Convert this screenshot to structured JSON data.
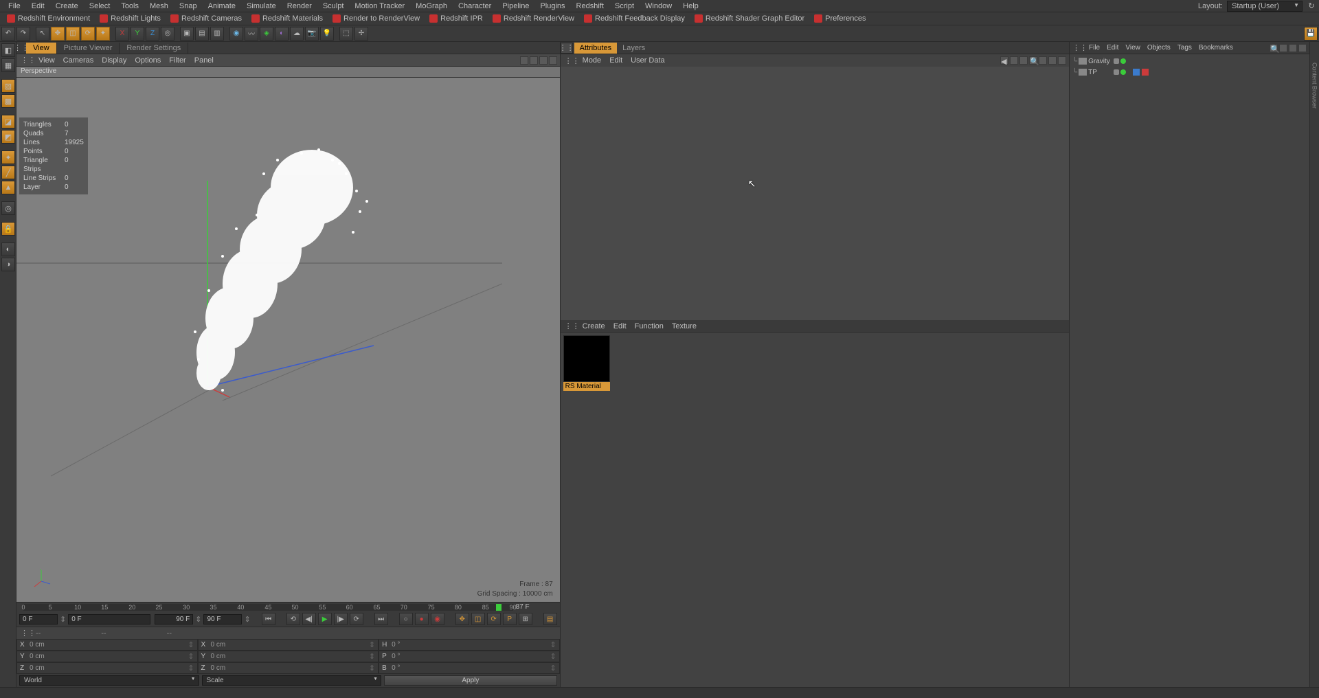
{
  "menubar": [
    "File",
    "Edit",
    "Create",
    "Select",
    "Tools",
    "Mesh",
    "Snap",
    "Animate",
    "Simulate",
    "Render",
    "Sculpt",
    "Motion Tracker",
    "MoGraph",
    "Character",
    "Pipeline",
    "Plugins",
    "Redshift",
    "Script",
    "Window",
    "Help"
  ],
  "layout": {
    "label": "Layout:",
    "value": "Startup (User)"
  },
  "redshift_tabs": [
    "Redshift Environment",
    "Redshift Lights",
    "Redshift Cameras",
    "Redshift Materials",
    "Render to RenderView",
    "Redshift IPR",
    "Redshift RenderView",
    "Redshift Feedback Display",
    "Redshift Shader Graph Editor",
    "Preferences"
  ],
  "view_tabs": {
    "items": [
      "View",
      "Picture Viewer",
      "Render Settings"
    ],
    "active": 0
  },
  "view_menus": [
    "View",
    "Cameras",
    "Display",
    "Options",
    "Filter",
    "Panel"
  ],
  "perspective": "Perspective",
  "stats": [
    {
      "label": "Triangles",
      "value": "0"
    },
    {
      "label": "Quads",
      "value": "7"
    },
    {
      "label": "Lines",
      "value": "19925"
    },
    {
      "label": "Points",
      "value": "0"
    },
    {
      "label": "Triangle Strips",
      "value": "0"
    },
    {
      "label": "Line Strips",
      "value": "0"
    },
    {
      "label": "Layer",
      "value": "0"
    }
  ],
  "frame_info": "Frame : 87",
  "grid_info": "Grid Spacing : 10000 cm",
  "timeline": {
    "start": 0,
    "end": 90,
    "current": 87,
    "start_field": "0 F",
    "cur_field": "0 F",
    "end_field": "90 F",
    "end_field2": "90 F",
    "frame_label": "87 F"
  },
  "coords": {
    "row1": [
      {
        "l": "X",
        "v": "0 cm"
      },
      {
        "l": "X",
        "v": "0 cm"
      },
      {
        "l": "H",
        "v": "0 °"
      }
    ],
    "row2": [
      {
        "l": "Y",
        "v": "0 cm"
      },
      {
        "l": "Y",
        "v": "0 cm"
      },
      {
        "l": "P",
        "v": "0 °"
      }
    ],
    "row3": [
      {
        "l": "Z",
        "v": "0 cm"
      },
      {
        "l": "Z",
        "v": "0 cm"
      },
      {
        "l": "B",
        "v": "0 °"
      }
    ]
  },
  "bottom": {
    "world": "World",
    "scale": "Scale",
    "apply": "Apply"
  },
  "attributes": {
    "tabs": [
      "Attributes",
      "Layers"
    ],
    "menus": [
      "Mode",
      "Edit",
      "User Data"
    ]
  },
  "materials": {
    "menus": [
      "Create",
      "Edit",
      "Function",
      "Texture"
    ],
    "item": "RS Material"
  },
  "objects": {
    "menus": [
      "File",
      "Edit",
      "View",
      "Objects",
      "Tags",
      "Bookmarks"
    ],
    "tree": [
      {
        "name": "Gravity"
      },
      {
        "name": "TP"
      }
    ]
  }
}
